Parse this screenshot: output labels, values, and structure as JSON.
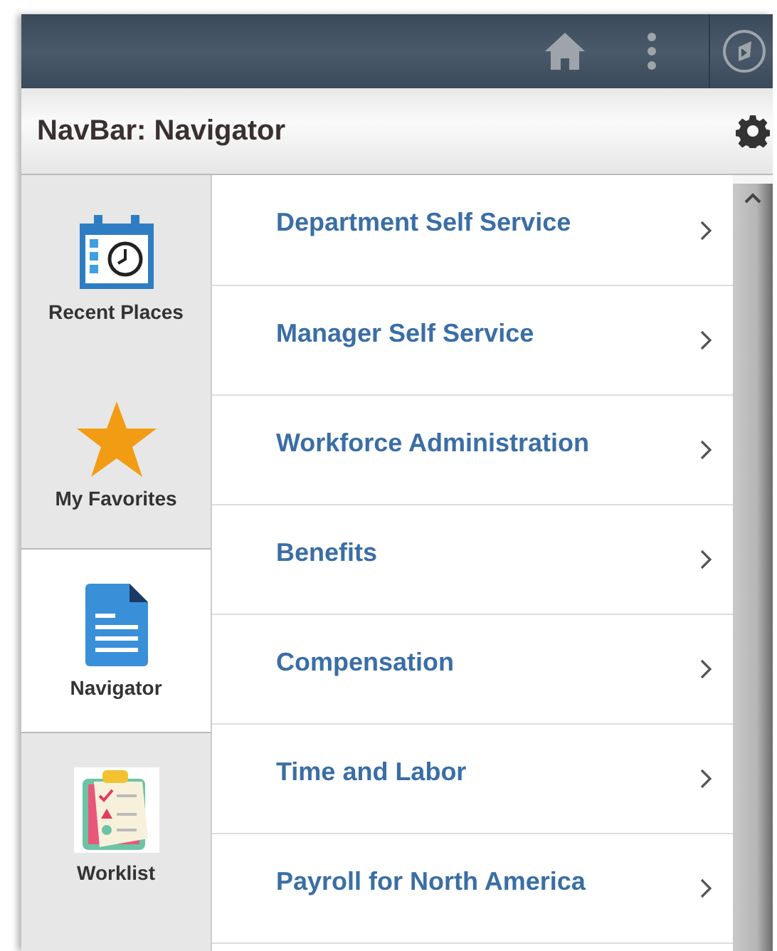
{
  "header": {
    "title": "NavBar: Navigator"
  },
  "sidebar": {
    "items": [
      {
        "label": "Recent Places",
        "kind": "calendar",
        "selected": false
      },
      {
        "label": "My Favorites",
        "kind": "star",
        "selected": false
      },
      {
        "label": "Navigator",
        "kind": "document",
        "selected": true
      },
      {
        "label": "Worklist",
        "kind": "clipboard",
        "selected": false
      }
    ]
  },
  "menu": {
    "items": [
      {
        "label": "Department Self Service"
      },
      {
        "label": "Manager Self Service"
      },
      {
        "label": "Workforce Administration"
      },
      {
        "label": "Benefits"
      },
      {
        "label": "Compensation"
      },
      {
        "label": "Time and Labor"
      },
      {
        "label": "Payroll for North America"
      }
    ]
  }
}
